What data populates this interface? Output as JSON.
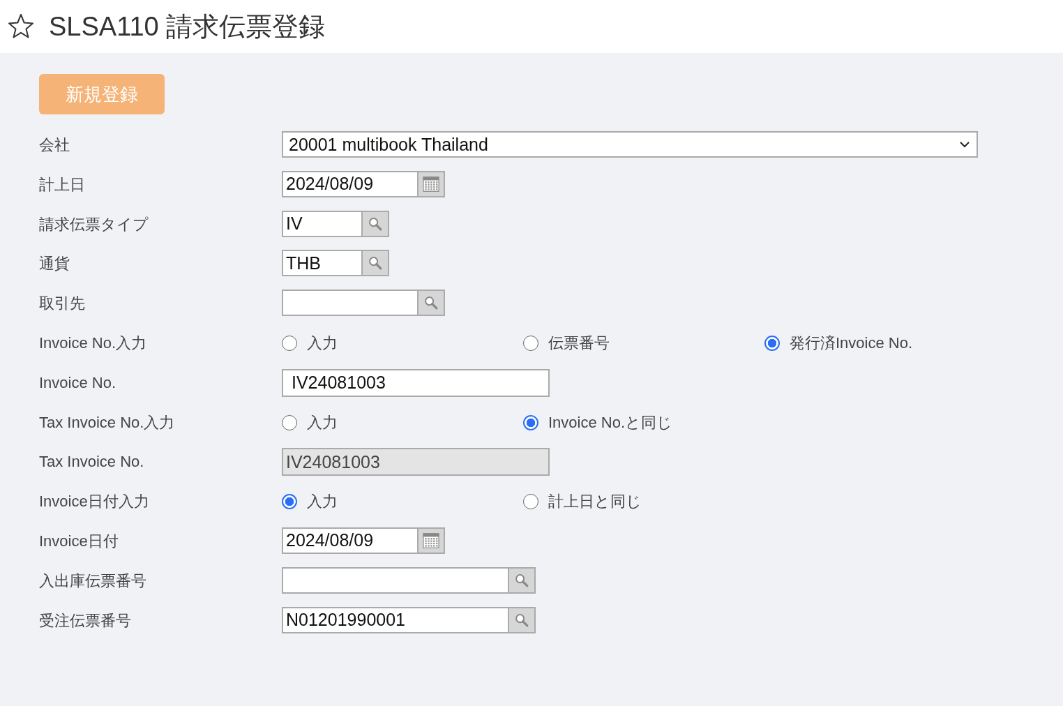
{
  "header": {
    "title": "SLSA110 請求伝票登録",
    "favorite": false
  },
  "new_button": "新規登録",
  "rows": [
    {
      "label": "会社",
      "kind": "select",
      "value": "20001 multibook Thailand"
    },
    {
      "label": "計上日",
      "kind": "date",
      "value": "2024/08/09"
    },
    {
      "label": "請求伝票タイプ",
      "kind": "code",
      "value": "IV"
    },
    {
      "label": "通貨",
      "kind": "code",
      "value": "THB"
    },
    {
      "label": "取引先",
      "kind": "lookup",
      "value": ""
    },
    {
      "label": "Invoice No.入力",
      "kind": "radio",
      "options": [
        {
          "label": "入力",
          "selected": false
        },
        {
          "label": "伝票番号",
          "selected": false
        },
        {
          "label": "発行済Invoice No.",
          "selected": true
        }
      ]
    },
    {
      "label": "Invoice No.",
      "kind": "text",
      "value": "IV24081003",
      "disabled": false
    },
    {
      "label": "Tax Invoice No.入力",
      "kind": "radio",
      "options": [
        {
          "label": "入力",
          "selected": false
        },
        {
          "label": "Invoice No.と同じ",
          "selected": true
        }
      ]
    },
    {
      "label": "Tax Invoice No.",
      "kind": "text",
      "value": "IV24081003",
      "disabled": true
    },
    {
      "label": "Invoice日付入力",
      "kind": "radio",
      "options": [
        {
          "label": "入力",
          "selected": true
        },
        {
          "label": "計上日と同じ",
          "selected": false
        }
      ]
    },
    {
      "label": "Invoice日付",
      "kind": "date",
      "value": "2024/08/09"
    },
    {
      "label": "入出庫伝票番号",
      "kind": "search",
      "value": ""
    },
    {
      "label": "受注伝票番号",
      "kind": "search",
      "value": "N01201990001"
    }
  ]
}
